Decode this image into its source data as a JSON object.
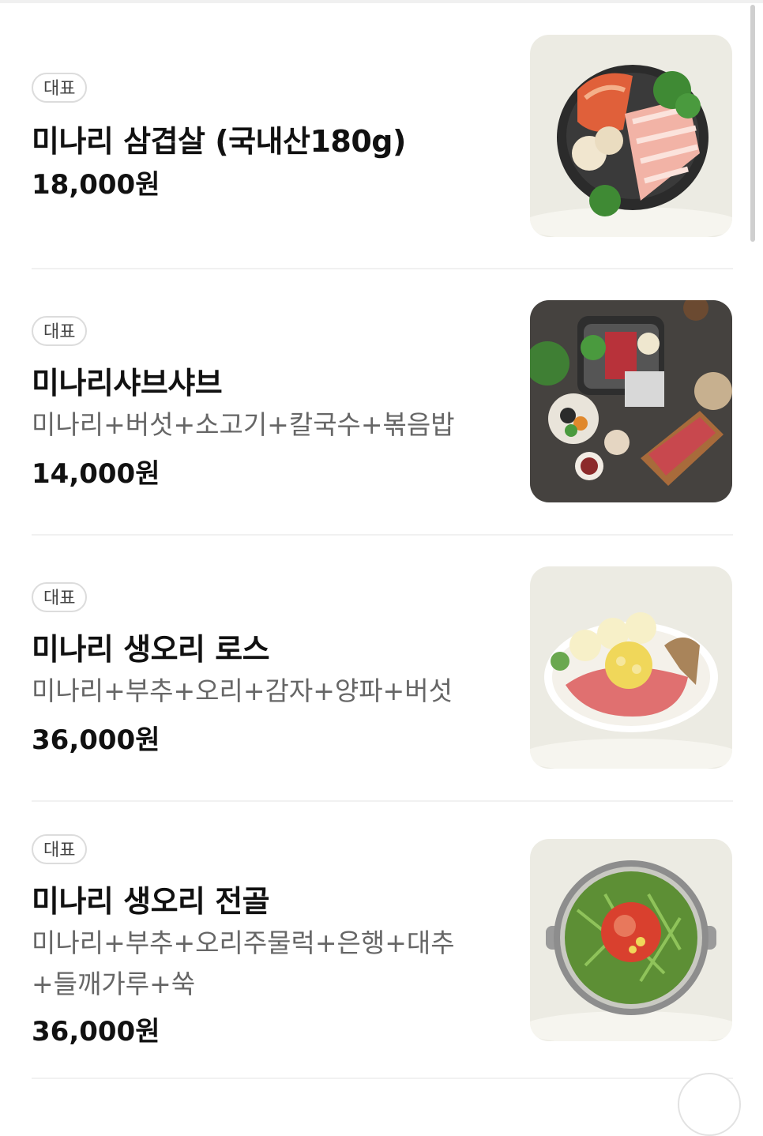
{
  "menu": {
    "items": [
      {
        "badge": "대표",
        "name": "미나리 삼겹살 (국내산180g)",
        "description": "",
        "price": "18,000원",
        "image_icon": "pork-belly-grill-photo"
      },
      {
        "badge": "대표",
        "name": "미나리샤브샤브",
        "description": "미나리+버섯+소고기+칼국수+볶음밥",
        "price": "14,000원",
        "image_icon": "shabu-shabu-set-photo"
      },
      {
        "badge": "대표",
        "name": "미나리 생오리 로스",
        "description": "미나리+부추+오리+감자+양파+버섯",
        "price": "36,000원",
        "image_icon": "duck-roast-plate-photo"
      },
      {
        "badge": "대표",
        "name": "미나리 생오리 전골",
        "description": "미나리+부추+오리주물럭+은행+대추+들깨가루+쑥",
        "price": "36,000원",
        "image_icon": "duck-hotpot-photo"
      }
    ]
  },
  "colors": {
    "thumb_light_bg": "#ecebe3",
    "thumb_dark_bg": "#4a4744",
    "badge_border": "#dcdcdc"
  }
}
